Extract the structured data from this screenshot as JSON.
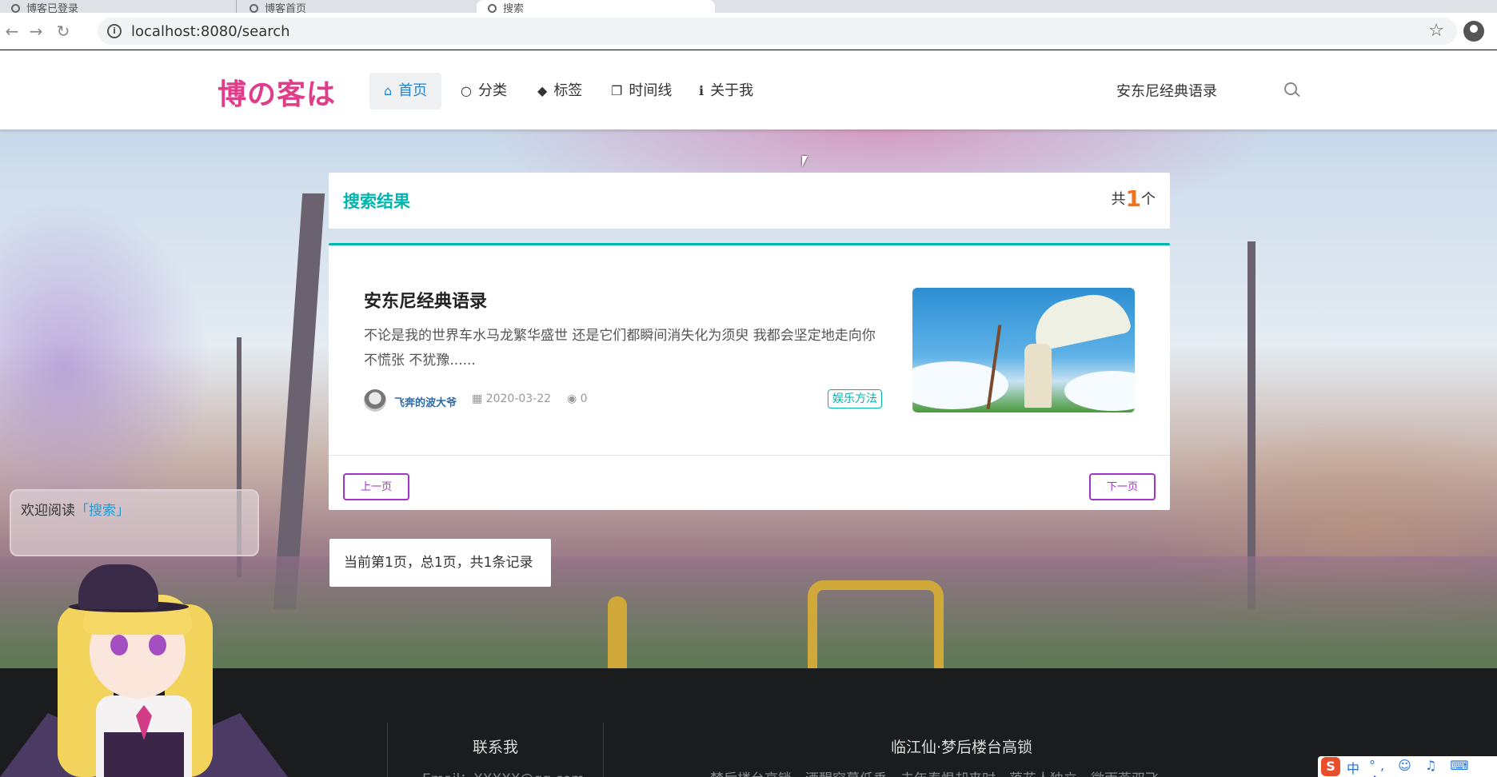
{
  "browser": {
    "tabs": [
      {
        "label": "博客已登录"
      },
      {
        "label": "博客首页"
      },
      {
        "label": "搜索"
      },
      {
        "label": ""
      }
    ],
    "url": "localhost:8080/search"
  },
  "header": {
    "logo": "博の客は",
    "menu": [
      {
        "icon": "home-icon",
        "label": "首页",
        "active": true
      },
      {
        "icon": "lightbulb-icon",
        "label": "分类"
      },
      {
        "icon": "tags-icon",
        "label": "标签"
      },
      {
        "icon": "clone-icon",
        "label": "时间线"
      },
      {
        "icon": "info-icon",
        "label": "关于我"
      }
    ],
    "search": {
      "value": "安东尼经典语录"
    }
  },
  "results": {
    "title": "搜索结果",
    "count_prefix": "共",
    "count": "1",
    "count_suffix": "个"
  },
  "post": {
    "title": "安东尼经典语录",
    "excerpt": "不论是我的世界车水马龙繁华盛世 还是它们都瞬间消失化为须臾 我都会坚定地走向你 不慌张 不犹豫......",
    "author": "飞奔的波大爷",
    "date": "2020-03-22",
    "views": "0",
    "tag": "娱乐方法"
  },
  "pager": {
    "prev": "上一页",
    "next": "下一页",
    "info": "当前第1页，总1页，共1条记录"
  },
  "welcome": {
    "text": "欢迎阅读",
    "highlight": "「搜索」"
  },
  "footer": {
    "contact_title": "联系我",
    "contact_email": "Email：XXXXX@qq.com",
    "poem_title": "临江仙·梦后楼台高锁",
    "poem_line": "梦后楼台高锁，酒醒帘幕低垂。去年春恨却来时。落花人独立，微雨燕双飞。"
  },
  "ime": {
    "zh": "中",
    "tools": "°, ☺ ♫ ⌨ ♟"
  },
  "colors": {
    "accent": "#00b5ad",
    "logo": "#e03c8a",
    "pager": "#a333c8",
    "count": "#f2711c"
  }
}
